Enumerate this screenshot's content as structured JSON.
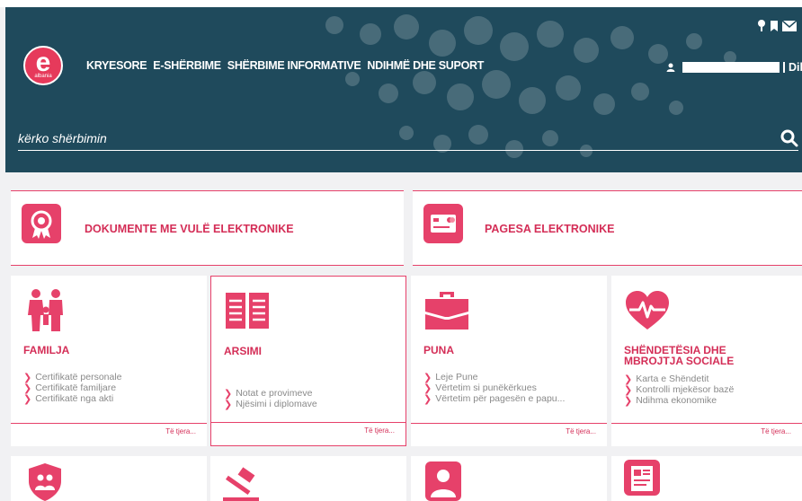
{
  "logo": {
    "letter": "e",
    "sub": "albania"
  },
  "nav": [
    "KRYESORE",
    "E-SHËRBIME",
    "SHËRBIME INFORMATIVE",
    "NDIHMË DHE SUPORT"
  ],
  "user": {
    "name": "Dil"
  },
  "search": {
    "placeholder": "kërko shërbimin"
  },
  "banners": [
    {
      "label": "DOKUMENTE ME VULË ELEKTRONIKE",
      "icon": "certificate-ribbon-icon"
    },
    {
      "label": "PAGESA ELEKTRONIKE",
      "icon": "credit-card-icon"
    }
  ],
  "cards": [
    {
      "title": "FAMILJA",
      "icon": "family-icon",
      "items": [
        "Certifikatë personale",
        "Certifikatë familjare",
        "Certifikatë nga akti"
      ],
      "more": "Të tjera..."
    },
    {
      "title": "ARSIMI",
      "icon": "open-book-icon",
      "items": [
        "Notat e provimeve",
        "Njësimi i diplomave"
      ],
      "more": "Të tjera..."
    },
    {
      "title": "PUNA",
      "icon": "briefcase-icon",
      "items": [
        "Leje Pune",
        "Vërtetim si punëkërkues",
        "Vërtetim për pagesën e papu..."
      ],
      "more": "Të tjera..."
    },
    {
      "title": "SHËNDETËSIA DHE MBROJTJA SOCIALE",
      "icon": "heartbeat-icon",
      "items": [
        "Karta e Shëndetit",
        "Kontrolli mjekësor bazë",
        "Ndihma ekonomike"
      ],
      "more": "Të tjera..."
    }
  ],
  "bottom_cards": [
    {
      "icon": "shield-family-icon"
    },
    {
      "icon": "gavel-icon"
    },
    {
      "icon": "person-badge-icon"
    },
    {
      "icon": "document-id-icon"
    }
  ],
  "colors": {
    "header_bg": "#1f4a5c",
    "accent": "#e6416a",
    "accent_text": "#d42e57"
  }
}
